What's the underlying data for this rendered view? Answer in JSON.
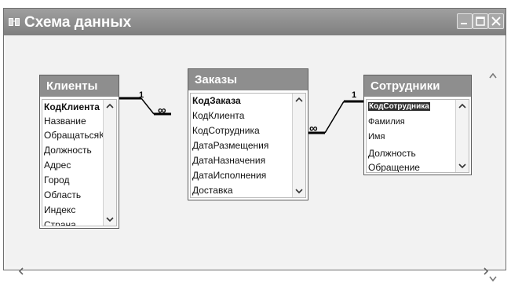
{
  "window": {
    "title": "Схема данных"
  },
  "tables": {
    "clients": {
      "title": "Клиенты",
      "fields": [
        "КодКлиента",
        "Название",
        "ОбращатьсяК",
        "Должность",
        "Адрес",
        "Город",
        "Область",
        "Индекс",
        "Страна"
      ]
    },
    "orders": {
      "title": "Заказы",
      "fields": [
        "КодЗаказа",
        "КодКлиента",
        "КодСотрудника",
        "ДатаРазмещения",
        "ДатаНазначения",
        "ДатаИсполнения",
        "Доставка"
      ]
    },
    "employees": {
      "title": "Сотрудники",
      "fields": [
        "КодСотрудника",
        "Фамилия",
        "Имя",
        "Должность",
        "Обращение"
      ]
    }
  },
  "relations": {
    "clients_orders": {
      "one": "1",
      "many": "∞"
    },
    "employees_orders": {
      "one": "1",
      "many": "∞"
    }
  }
}
